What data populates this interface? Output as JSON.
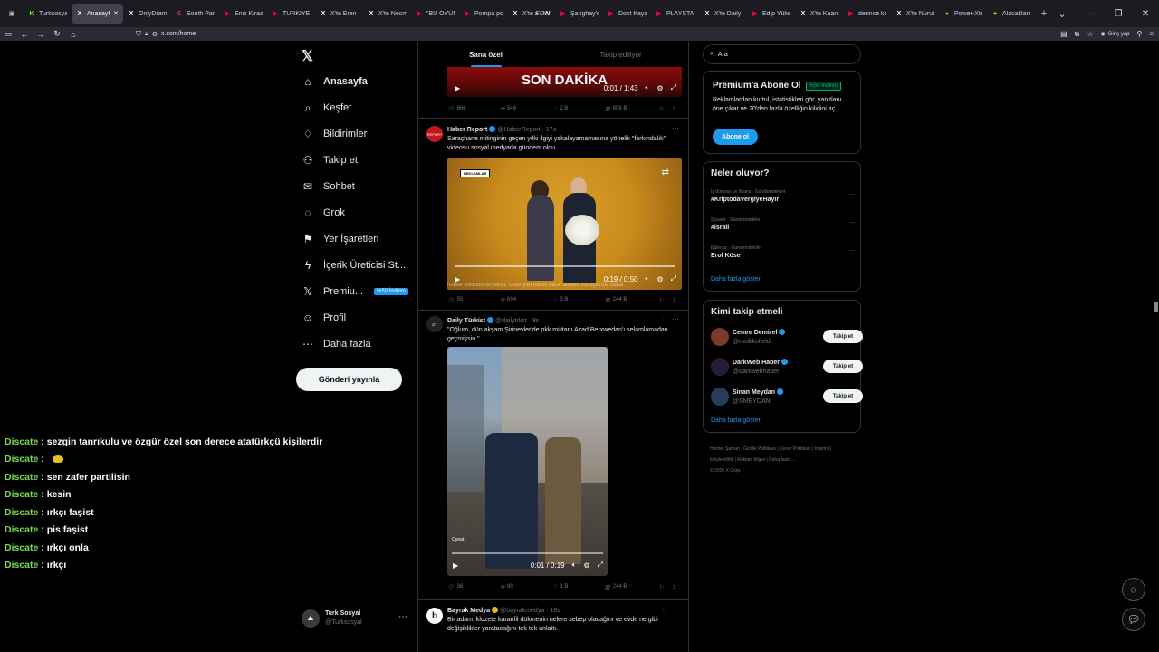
{
  "browser": {
    "tabs": [
      {
        "label": "Turksosyal",
        "fav": "K",
        "color": "#53fc18"
      },
      {
        "label": "Anasayfa",
        "fav": "X",
        "color": "#ffffff",
        "active": true
      },
      {
        "label": "OnlyDrama",
        "fav": "X",
        "color": "#ffffff"
      },
      {
        "label": "South Park",
        "fav": "S",
        "color": "#e0292c"
      },
      {
        "label": "Enis Kirazoğ",
        "fav": "▶",
        "color": "#ff0033"
      },
      {
        "label": "TÜRKİYE NA",
        "fav": "▶",
        "color": "#ff0033"
      },
      {
        "label": "X'te Eren Ca",
        "fav": "X",
        "color": "#ffffff"
      },
      {
        "label": "X'te Necmi T",
        "fav": "X",
        "color": "#ffffff"
      },
      {
        "label": "\"BU OYUN",
        "fav": "▶",
        "color": "#ff0033"
      },
      {
        "label": "Pompa pom",
        "fav": "▶",
        "color": "#ff0033"
      },
      {
        "label": "X'te 𝙎𝙊𝙉𝙎",
        "fav": "X",
        "color": "#ffffff"
      },
      {
        "label": "Şanghay'da",
        "fav": "▶",
        "color": "#ff0033"
      },
      {
        "label": "Dost Kayaoğ",
        "fav": "▶",
        "color": "#ff0033"
      },
      {
        "label": "PLAYSTATIO",
        "fav": "▶",
        "color": "#ff0033"
      },
      {
        "label": "X'te Daily Tü",
        "fav": "X",
        "color": "#ffffff"
      },
      {
        "label": "Edip Yüksel",
        "fav": "▶",
        "color": "#ff0033"
      },
      {
        "label": "X'te Kaan Ar",
        "fav": "X",
        "color": "#ffffff"
      },
      {
        "label": "derince kazı",
        "fav": "▶",
        "color": "#ff0033"
      },
      {
        "label": "X'te Nurull",
        "fav": "X",
        "color": "#ffffff"
      },
      {
        "label": "Power-Xtra",
        "fav": "●",
        "color": "#f08a24"
      },
      {
        "label": "Alacaklarım",
        "fav": "+",
        "color": "#f5c518"
      }
    ],
    "url": "x.com/home",
    "signin_label": "Giriş yap"
  },
  "nav": {
    "items": [
      {
        "label": "Anasayfa",
        "icon": "home-icon",
        "glyph": "⌂"
      },
      {
        "label": "Keşfet",
        "icon": "search-icon",
        "glyph": "⌕"
      },
      {
        "label": "Bildirimler",
        "icon": "bell-icon",
        "glyph": "♢"
      },
      {
        "label": "Takip et",
        "icon": "follow-icon",
        "glyph": "⚇"
      },
      {
        "label": "Sohbet",
        "icon": "mail-icon",
        "glyph": "✉"
      },
      {
        "label": "Grok",
        "icon": "grok-icon",
        "glyph": "◌"
      },
      {
        "label": "Yer İşaretleri",
        "icon": "bookmark-icon",
        "glyph": "⚑"
      },
      {
        "label": "İçerik Üreticisi St...",
        "icon": "lightning-icon",
        "glyph": "ϟ"
      },
      {
        "label": "Premiu...",
        "icon": "x-premium-icon",
        "glyph": "𝕏"
      },
      {
        "label": "Profil",
        "icon": "profile-icon",
        "glyph": "☺"
      },
      {
        "label": "Daha fazla",
        "icon": "more-circle-icon",
        "glyph": "⋯"
      }
    ],
    "premium_badge": "%50 İndirim",
    "post_button": "Gönderi yayınla",
    "account_name": "Turk Sosyal",
    "account_handle": "@Turksosyal"
  },
  "feed": {
    "tab_foryou": "Sana özel",
    "tab_following": "Takip ediliyor",
    "post0": {
      "banner_text": "SON DAKİKA",
      "time": "0:01 / 1:43",
      "replies": "866",
      "reposts": "546",
      "likes": "2 B",
      "views": "898 B"
    },
    "post1": {
      "name": "Haber Report",
      "handle": "@HaberReport",
      "age": "17s",
      "text": "Saraçhane mitinginin geçen yılki ilgiyi yakalayamamasına yönelik \"farkındalık\" videosu sosyal medyada gündem oldu.",
      "badge": "REKLAMLAR",
      "time": "0:19 / 0:50",
      "caption": "hunde bulundurulmalıdır. Olası yan etkiler karar alırken sonuçlarına bakal",
      "replies": "55",
      "reposts": "694",
      "likes": "3 B",
      "views": "244 B"
    },
    "post2": {
      "name": "Daily Türkist",
      "handle": "@dailytrkst",
      "age": "8s",
      "text": "\"Oğlum, dün akşam Şirinevler'de pkk militanı Azad Berxwedan'ı selamlamadan geçmişsin.\"",
      "play_label": "Oynat",
      "time": "0:01 / 0:19",
      "replies": "36",
      "reposts": "90",
      "likes": "1 B",
      "views": "244 B"
    },
    "post3": {
      "name": "Bayrak Medya",
      "handle": "@bayrakmedya",
      "age": "16s",
      "text": "Bir adam, klozete karanfil dökmenin nelere sebep olacağını ve evde ne gibi değişiklikler yaratacağını tek tek anlattı."
    }
  },
  "right": {
    "search_placeholder": "Ara",
    "premium": {
      "title": "Premium'a Abone Ol",
      "discount": "%50 İndirim",
      "desc": "Reklamlardan kurtul, istatistikleri gör, yanıtlanı öne çıkar ve 20'den fazla özelliğin kilidini aç.",
      "button": "Abone ol"
    },
    "trends": {
      "title": "Neler oluyor?",
      "items": [
        {
          "category": "İş dünyası ve finans · Gündemdekiler",
          "topic": "#KriptodaVergiyeHayır"
        },
        {
          "category": "Siyaset · Gündemdekiler",
          "topic": "#israil"
        },
        {
          "category": "Eğlence · Gündemdekiler",
          "topic": "Erol Köse"
        }
      ],
      "show_more": "Daha fazla göster"
    },
    "who_to_follow": {
      "title": "Kimi takip etmeli",
      "items": [
        {
          "name": "Cemre Demirel",
          "handle": "@msikkofield",
          "button": "Takip et"
        },
        {
          "name": "DarkWeb Haber",
          "handle": "@darkwebhaber",
          "button": "Takip et"
        },
        {
          "name": "Sinan Meydan",
          "handle": "@SMEYDAN",
          "button": "Takip et"
        }
      ],
      "show_more": "Daha fazla göster"
    },
    "footer": {
      "links": [
        "Hizmet Şartları",
        "Gizlilik Politikası",
        "Çerez Politikası",
        "Imprint",
        "Erişilebilirlik",
        "Reklam bilgisi",
        "Daha fazla ..."
      ],
      "copyright": "© 2026 X Corp."
    }
  },
  "chat": [
    {
      "user": "Discate",
      "msg": "sezgin tanrıkulu ve özgür özel son derece atatürkçü kişilerdir"
    },
    {
      "user": "Discate",
      "msg": ""
    },
    {
      "user": "Discate",
      "msg": "sen zafer partilisin"
    },
    {
      "user": "Discate",
      "msg": "kesin"
    },
    {
      "user": "Discate",
      "msg": "ırkçı faşist"
    },
    {
      "user": "Discate",
      "msg": "pis faşist"
    },
    {
      "user": "Discate",
      "msg": "ırkçı onla"
    },
    {
      "user": "Discate",
      "msg": "ırkçı"
    }
  ]
}
